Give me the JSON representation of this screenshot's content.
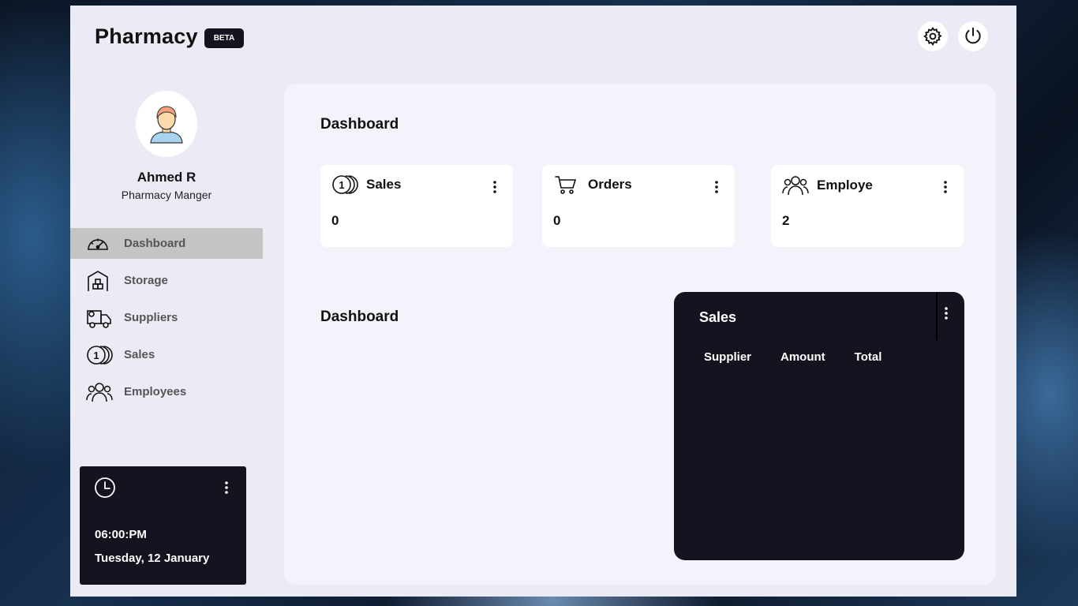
{
  "app": {
    "title": "Pharmacy",
    "badge": "BETA"
  },
  "profile": {
    "name": "Ahmed R",
    "role": "Pharmacy Manger"
  },
  "sidebar": {
    "items": [
      {
        "label": "Dashboard",
        "icon": "speedometer-icon",
        "active": true
      },
      {
        "label": "Storage",
        "icon": "warehouse-icon"
      },
      {
        "label": "Suppliers",
        "icon": "delivery-truck-icon"
      },
      {
        "label": "Sales",
        "icon": "coins-icon"
      },
      {
        "label": "Employees",
        "icon": "people-icon"
      }
    ]
  },
  "clock": {
    "time": "06:00:PM",
    "date": "Tuesday, 12 January"
  },
  "main": {
    "title": "Dashboard",
    "cards": [
      {
        "label": "Sales",
        "value": "0",
        "icon": "coins-icon"
      },
      {
        "label": "Orders",
        "value": "0",
        "icon": "cart-icon"
      },
      {
        "label": "Employe",
        "value": "2",
        "icon": "people-icon"
      }
    ],
    "section_title": "Dashboard",
    "sales_panel": {
      "title": "Sales",
      "columns": [
        "Supplier",
        "Amount",
        "Total"
      ]
    }
  }
}
